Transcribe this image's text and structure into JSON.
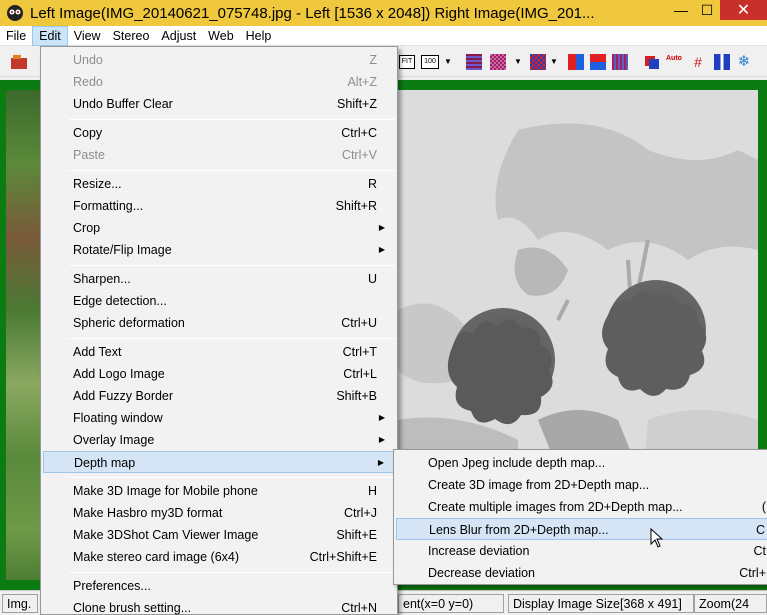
{
  "window": {
    "title": "Left Image(IMG_20140621_075748.jpg - Left [1536 x 2048]) Right Image(IMG_201...",
    "minimize": "—",
    "maximize": "☐",
    "close": "✕"
  },
  "menubar": [
    "File",
    "Edit",
    "View",
    "Stereo",
    "Adjust",
    "Web",
    "Help"
  ],
  "toolbar": {
    "fit_label": "FIT",
    "zoom100_label": "100"
  },
  "edit_menu": [
    {
      "label": "Undo",
      "shortcut": "Z",
      "disabled": true
    },
    {
      "label": "Redo",
      "shortcut": "Alt+Z",
      "disabled": true
    },
    {
      "label": "Undo Buffer Clear",
      "shortcut": "Shift+Z"
    },
    {
      "label": "Copy",
      "shortcut": "Ctrl+C"
    },
    {
      "label": "Paste",
      "shortcut": "Ctrl+V",
      "disabled": true
    },
    {
      "label": "Resize...",
      "shortcut": "R"
    },
    {
      "label": "Formatting...",
      "shortcut": "Shift+R"
    },
    {
      "label": "Crop",
      "submenu": true
    },
    {
      "label": "Rotate/Flip Image",
      "submenu": true
    },
    {
      "label": "Sharpen...",
      "shortcut": "U"
    },
    {
      "label": "Edge detection..."
    },
    {
      "label": "Spheric deformation",
      "shortcut": "Ctrl+U"
    },
    {
      "label": "Add Text",
      "shortcut": "Ctrl+T"
    },
    {
      "label": "Add Logo Image",
      "shortcut": "Ctrl+L"
    },
    {
      "label": "Add Fuzzy Border",
      "shortcut": "Shift+B"
    },
    {
      "label": "Floating window",
      "submenu": true
    },
    {
      "label": "Overlay Image",
      "submenu": true
    },
    {
      "label": "Depth map",
      "submenu": true,
      "highlighted": true
    },
    {
      "label": "Make 3D Image for Mobile phone",
      "shortcut": "H"
    },
    {
      "label": "Make Hasbro my3D format",
      "shortcut": "Ctrl+J"
    },
    {
      "label": "Make 3DShot Cam Viewer Image",
      "shortcut": "Shift+E"
    },
    {
      "label": "Make stereo card image (6x4)",
      "shortcut": "Ctrl+Shift+E"
    },
    {
      "label": "Preferences..."
    },
    {
      "label": "Clone brush setting...",
      "shortcut": "Ctrl+N"
    }
  ],
  "depth_submenu": [
    {
      "label": "Open Jpeg include depth map...",
      "shortcut": ""
    },
    {
      "label": "Create 3D image from 2D+Depth map...",
      "shortcut": ""
    },
    {
      "label": "Create multiple images from 2D+Depth map...",
      "shortcut": "("
    },
    {
      "label": "Lens Blur from 2D+Depth map...",
      "shortcut": "C",
      "highlighted": true
    },
    {
      "label": "Increase deviation",
      "shortcut": "Ct"
    },
    {
      "label": "Decrease deviation",
      "shortcut": "Ctrl+"
    }
  ],
  "status": {
    "left": "Img.",
    "mid": "ent(x=0 y=0)",
    "display_size": "Display Image Size[368 x 491]",
    "zoom": "Zoom(24"
  },
  "colors": {
    "title_bg": "#f0c83e",
    "close_bg": "#c7302b",
    "frame_green": "#0a7c12",
    "highlight": "#d5e5f6"
  }
}
